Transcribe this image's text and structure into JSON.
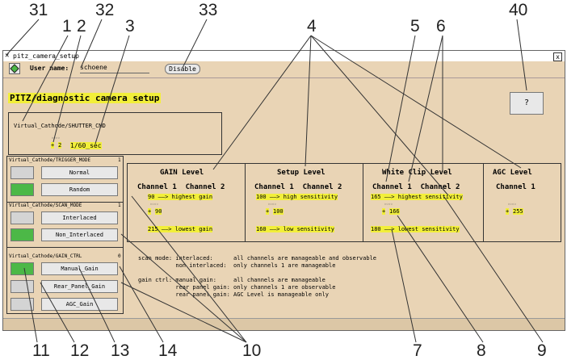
{
  "callouts": [
    "31",
    "1",
    "32",
    "2",
    "3",
    "33",
    "4",
    "5",
    "6",
    "40",
    "11",
    "12",
    "13",
    "14",
    "10",
    "7",
    "8",
    "9"
  ],
  "window": {
    "title": "pitz_camera_setup",
    "title_mark": "✕",
    "close_label": "x",
    "user_label": "User name:",
    "user_value": "schoene",
    "disable_label": "Disable",
    "help_label": "?",
    "heading": "PITZ/diagnostic camera setup"
  },
  "shutter": {
    "title": "Virtual_Cathode/SHUTTER_CMD",
    "value": "2",
    "arrow": "+",
    "text": "1/60_sec"
  },
  "trigger": {
    "title": "Virtual_Cathode/TRIGGER_MODE",
    "count": "1",
    "options": [
      "Normal",
      "Random"
    ]
  },
  "scan": {
    "title": "Virtual_Cathode/SCAN_MODE",
    "count": "1",
    "options": [
      "Interlaced",
      "Non_Interlaced"
    ]
  },
  "gainctrl": {
    "title": "Virtual_Cathode/GAIN_CTRL",
    "count": "0",
    "options": [
      "Manual_Gain",
      "Rear_Panel_Gain",
      "AGC_Gain"
    ]
  },
  "levels": {
    "gain": {
      "title": "GAIN Level",
      "channels": "Channel 1  Channel 2",
      "top": "90 ——> highest gain",
      "value": "90",
      "bottom": "215 ——> lowest gain"
    },
    "setup": {
      "title": "Setup Level",
      "channels": "Channel 1  Channel 2",
      "top": "100 ——> high sensitivity",
      "value": "100",
      "bottom": "160 ——> low sensitivity"
    },
    "white": {
      "title": "White Clip Level",
      "channels": "Channel 1  Channel 2",
      "top": "165 ——> highest sensitivity",
      "value": "166",
      "bottom": "180 ——> lowest sensitivity"
    },
    "agc": {
      "title": "AGC Level",
      "channels": "Channel 1",
      "value": "255"
    }
  },
  "notes": [
    "scan mode: interlaced:      all channels are manageable and observable",
    "           non interlaced:  only channels 1 are manageable",
    "",
    "gain ctrl: manual gain:     all channels are manageable",
    "           rear panel gain: only channels 1 are observable",
    "           rear panel gain: AGC Level is manageable only"
  ],
  "colors": {
    "window_bg": "#e9d4b5",
    "highlight": "#f2ef3a",
    "led_on": "#4cb847",
    "led_off": "#d4d4d4"
  }
}
